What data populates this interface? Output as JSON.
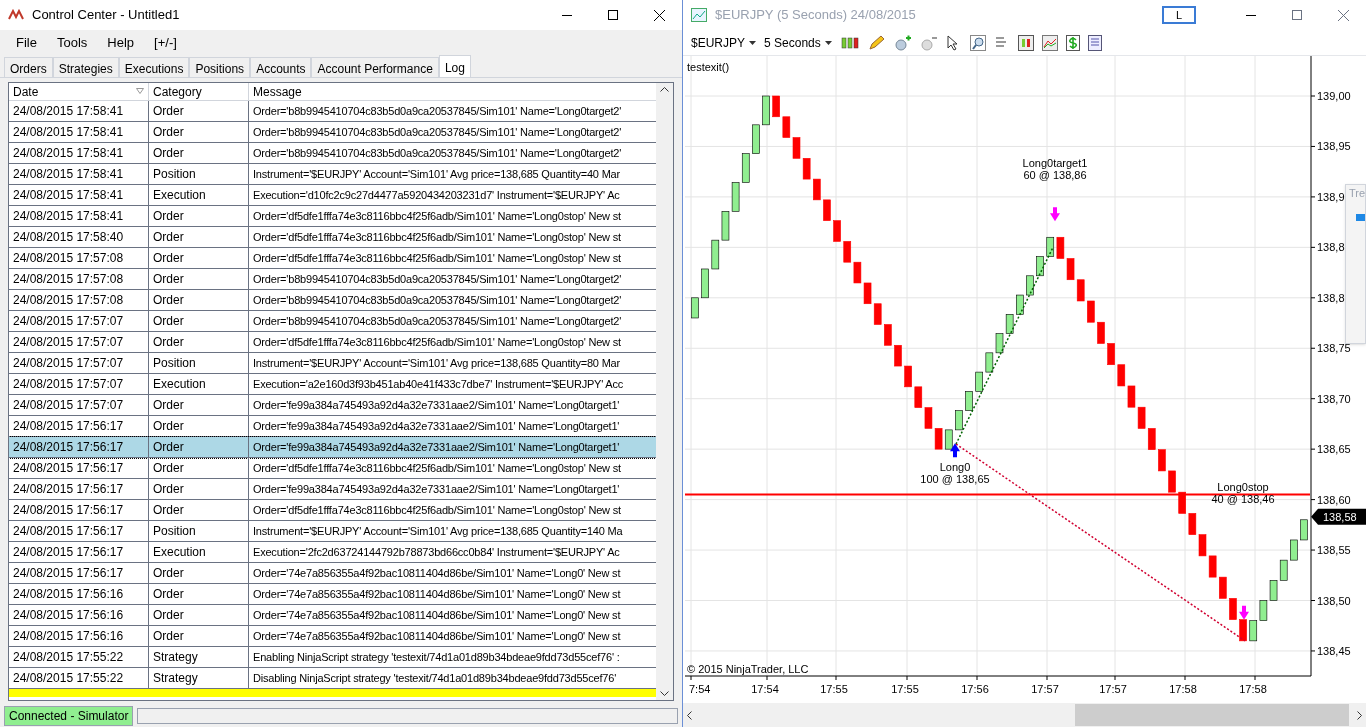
{
  "control_center": {
    "title": "Control Center - Untitled1",
    "menu": [
      "File",
      "Tools",
      "Help",
      "[+/-]"
    ],
    "tabs": [
      {
        "label": "Orders",
        "selected": false
      },
      {
        "label": "Strategies",
        "selected": false
      },
      {
        "label": "Executions",
        "selected": false
      },
      {
        "label": "Positions",
        "selected": false
      },
      {
        "label": "Accounts",
        "selected": false
      },
      {
        "label": "Account Performance",
        "selected": false
      },
      {
        "label": "Log",
        "selected": true
      }
    ],
    "columns": [
      "Date",
      "Category",
      "Message"
    ],
    "rows": [
      {
        "date": "24/08/2015 17:58:41",
        "category": "Order",
        "message": "Order='b8b9945410704c83b5d0a9ca20537845/Sim101'  Name='Long0target2'",
        "selected": false
      },
      {
        "date": "24/08/2015 17:58:41",
        "category": "Order",
        "message": "Order='b8b9945410704c83b5d0a9ca20537845/Sim101'  Name='Long0target2'",
        "selected": false
      },
      {
        "date": "24/08/2015 17:58:41",
        "category": "Order",
        "message": "Order='b8b9945410704c83b5d0a9ca20537845/Sim101'  Name='Long0target2'",
        "selected": false
      },
      {
        "date": "24/08/2015 17:58:41",
        "category": "Position",
        "message": "Instrument='$EURJPY' Account='Sim101' Avg price=138,685 Quantity=40 Mar",
        "selected": false
      },
      {
        "date": "24/08/2015 17:58:41",
        "category": "Execution",
        "message": "Execution='d10fc2c9c27d4477a5920434203231d7' Instrument='$EURJPY' Ac",
        "selected": false
      },
      {
        "date": "24/08/2015 17:58:41",
        "category": "Order",
        "message": "Order='df5dfe1fffa74e3c8116bbc4f25f6adb/Sim101' Name='Long0stop' New st",
        "selected": false
      },
      {
        "date": "24/08/2015 17:58:40",
        "category": "Order",
        "message": "Order='df5dfe1fffa74e3c8116bbc4f25f6adb/Sim101' Name='Long0stop' New st",
        "selected": false
      },
      {
        "date": "24/08/2015 17:57:08",
        "category": "Order",
        "message": "Order='df5dfe1fffa74e3c8116bbc4f25f6adb/Sim101' Name='Long0stop' New st",
        "selected": false
      },
      {
        "date": "24/08/2015 17:57:08",
        "category": "Order",
        "message": "Order='b8b9945410704c83b5d0a9ca20537845/Sim101'  Name='Long0target2'",
        "selected": false
      },
      {
        "date": "24/08/2015 17:57:08",
        "category": "Order",
        "message": "Order='b8b9945410704c83b5d0a9ca20537845/Sim101'  Name='Long0target2'",
        "selected": false
      },
      {
        "date": "24/08/2015 17:57:07",
        "category": "Order",
        "message": "Order='b8b9945410704c83b5d0a9ca20537845/Sim101'  Name='Long0target2'",
        "selected": false
      },
      {
        "date": "24/08/2015 17:57:07",
        "category": "Order",
        "message": "Order='df5dfe1fffa74e3c8116bbc4f25f6adb/Sim101' Name='Long0stop' New st",
        "selected": false
      },
      {
        "date": "24/08/2015 17:57:07",
        "category": "Position",
        "message": "Instrument='$EURJPY' Account='Sim101' Avg price=138,685 Quantity=80 Mar",
        "selected": false
      },
      {
        "date": "24/08/2015 17:57:07",
        "category": "Execution",
        "message": "Execution='a2e160d3f93b451ab40e41f433c7dbe7' Instrument='$EURJPY' Acc",
        "selected": false
      },
      {
        "date": "24/08/2015 17:57:07",
        "category": "Order",
        "message": "Order='fe99a384a745493a92d4a32e7331aae2/Sim101'  Name='Long0target1'",
        "selected": false
      },
      {
        "date": "24/08/2015 17:56:17",
        "category": "Order",
        "message": "Order='fe99a384a745493a92d4a32e7331aae2/Sim101'  Name='Long0target1'",
        "selected": false
      },
      {
        "date": "24/08/2015 17:56:17",
        "category": "Order",
        "message": "Order='fe99a384a745493a92d4a32e7331aae2/Sim101'  Name='Long0target1'",
        "selected": true
      },
      {
        "date": "24/08/2015 17:56:17",
        "category": "Order",
        "message": "Order='df5dfe1fffa74e3c8116bbc4f25f6adb/Sim101' Name='Long0stop' New st",
        "selected": false
      },
      {
        "date": "24/08/2015 17:56:17",
        "category": "Order",
        "message": "Order='fe99a384a745493a92d4a32e7331aae2/Sim101'  Name='Long0target1'",
        "selected": false
      },
      {
        "date": "24/08/2015 17:56:17",
        "category": "Order",
        "message": "Order='df5dfe1fffa74e3c8116bbc4f25f6adb/Sim101' Name='Long0stop' New st",
        "selected": false
      },
      {
        "date": "24/08/2015 17:56:17",
        "category": "Position",
        "message": "Instrument='$EURJPY' Account='Sim101' Avg price=138,685 Quantity=140 Ma",
        "selected": false
      },
      {
        "date": "24/08/2015 17:56:17",
        "category": "Execution",
        "message": "Execution='2fc2d63724144792b78873bd66cc0b84' Instrument='$EURJPY' Ac",
        "selected": false
      },
      {
        "date": "24/08/2015 17:56:17",
        "category": "Order",
        "message": "Order='74e7a856355a4f92bac10811404d86be/Sim101' Name='Long0' New st",
        "selected": false
      },
      {
        "date": "24/08/2015 17:56:16",
        "category": "Order",
        "message": "Order='74e7a856355a4f92bac10811404d86be/Sim101' Name='Long0' New st",
        "selected": false
      },
      {
        "date": "24/08/2015 17:56:16",
        "category": "Order",
        "message": "Order='74e7a856355a4f92bac10811404d86be/Sim101' Name='Long0' New st",
        "selected": false
      },
      {
        "date": "24/08/2015 17:56:16",
        "category": "Order",
        "message": "Order='74e7a856355a4f92bac10811404d86be/Sim101' Name='Long0' New st",
        "selected": false
      },
      {
        "date": "24/08/2015 17:55:22",
        "category": "Strategy",
        "message": "Enabling NinjaScript strategy 'testexit/74d1a01d89b34bdeae9fdd73d55cef76' :",
        "selected": false
      },
      {
        "date": "24/08/2015 17:55:22",
        "category": "Strategy",
        "message": "Disabling NinjaScript strategy 'testexit/74d1a01d89b34bdeae9fdd73d55cef76'",
        "selected": false
      }
    ],
    "status": "Connected - Simulator"
  },
  "chart_window": {
    "title": "$EURJPY (5 Seconds)  24/08/2015",
    "title_button": "L",
    "toolbar": [
      "$EURJPY",
      "5 Seconds"
    ],
    "indicator_label": "testexit()",
    "price_labels": [
      "139,00",
      "138,95",
      "138,9",
      "138,8",
      "138,8",
      "138,75",
      "138,70",
      "138,65",
      "138,60",
      "138,55",
      "138,50",
      "138,45"
    ],
    "last_price": "138,58",
    "time_labels": [
      "7:54",
      "17:54",
      "17:55",
      "17:55",
      "17:56",
      "17:57",
      "17:57",
      "17:58",
      "17:58"
    ],
    "markers": [
      {
        "kind": "entry",
        "name": "Long0",
        "detail": "100 @ 138,65"
      },
      {
        "kind": "exit",
        "name": "Long0target1",
        "detail": "60 @ 138,86"
      },
      {
        "kind": "exit",
        "name": "Long0stop",
        "detail": "40 @ 138,46"
      }
    ],
    "copyright": "© 2015 NinjaTrader, LLC",
    "popup_title": "Tre"
  }
}
